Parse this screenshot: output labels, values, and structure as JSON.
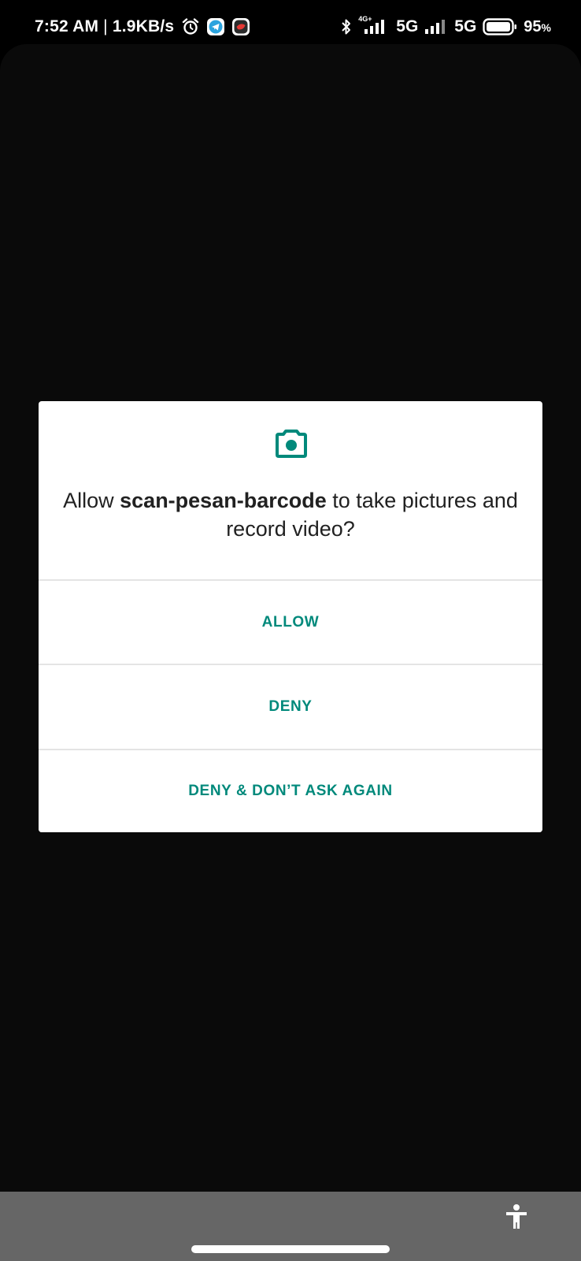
{
  "status_bar": {
    "time": "7:52 AM",
    "separator": "|",
    "net_speed": "1.9KB/s",
    "network_tag": "4G+",
    "network_1": "5G",
    "network_2": "5G",
    "battery_value": "95",
    "battery_unit": "%",
    "icons": [
      "alarm-icon",
      "telegram-icon",
      "app-notification-icon",
      "bluetooth-icon",
      "signal-icon",
      "battery-icon"
    ]
  },
  "dialog": {
    "message_prefix": "Allow ",
    "app_name": "scan-pesan-barcode",
    "message_suffix": " to take pictures and record video?",
    "icon": "camera-icon",
    "buttons": {
      "allow": "ALLOW",
      "deny": "DENY",
      "deny_never": "DENY & DON’T ASK AGAIN"
    }
  },
  "nav_bar": {
    "icon": "accessibility-icon"
  },
  "colors": {
    "accent": "#00897b",
    "dialog_bg": "#ffffff",
    "app_bg": "#0a0a0a",
    "nav_bg": "#666666"
  }
}
